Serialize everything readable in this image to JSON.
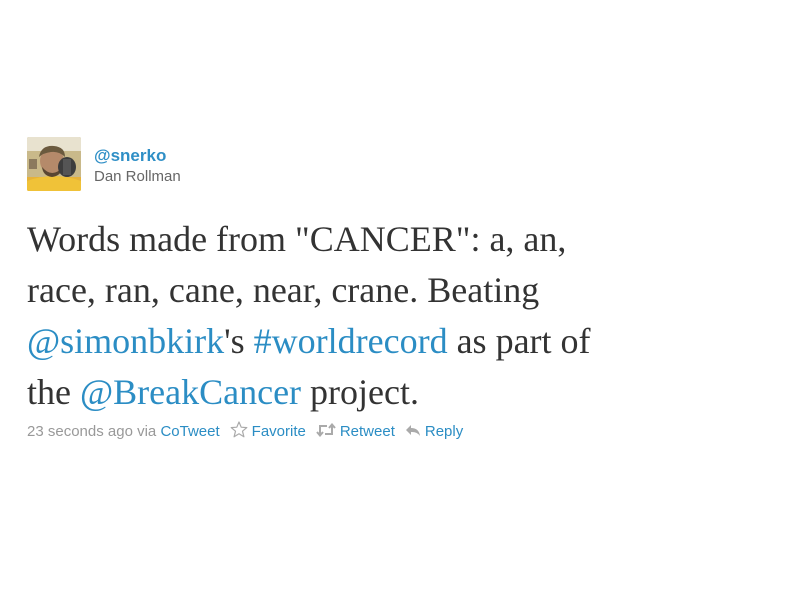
{
  "user": {
    "screen_name": "@snerko",
    "full_name": "Dan Rollman"
  },
  "tweet": {
    "line1": "Words made from \"CANCER\": a, an,",
    "line2": "race, ran, cane, near, crane. Beating",
    "mention1": "@simonbkirk",
    "after_mention1": "'s ",
    "hashtag": "#worldrecord",
    "after_hashtag": " as part of",
    "line4_prefix": "the ",
    "mention2": "@BreakCancer",
    "after_mention2": " project."
  },
  "meta": {
    "time": "23 seconds ago",
    "via": "via",
    "source": "CoTweet",
    "favorite_label": "Favorite",
    "retweet_label": "Retweet",
    "reply_label": "Reply"
  },
  "icons": {
    "favorite": "star-outline-icon",
    "retweet": "retweet-icon",
    "reply": "reply-arrow-icon"
  },
  "colors": {
    "link": "#2b8dc4",
    "text": "#333333",
    "meta": "#999999"
  }
}
